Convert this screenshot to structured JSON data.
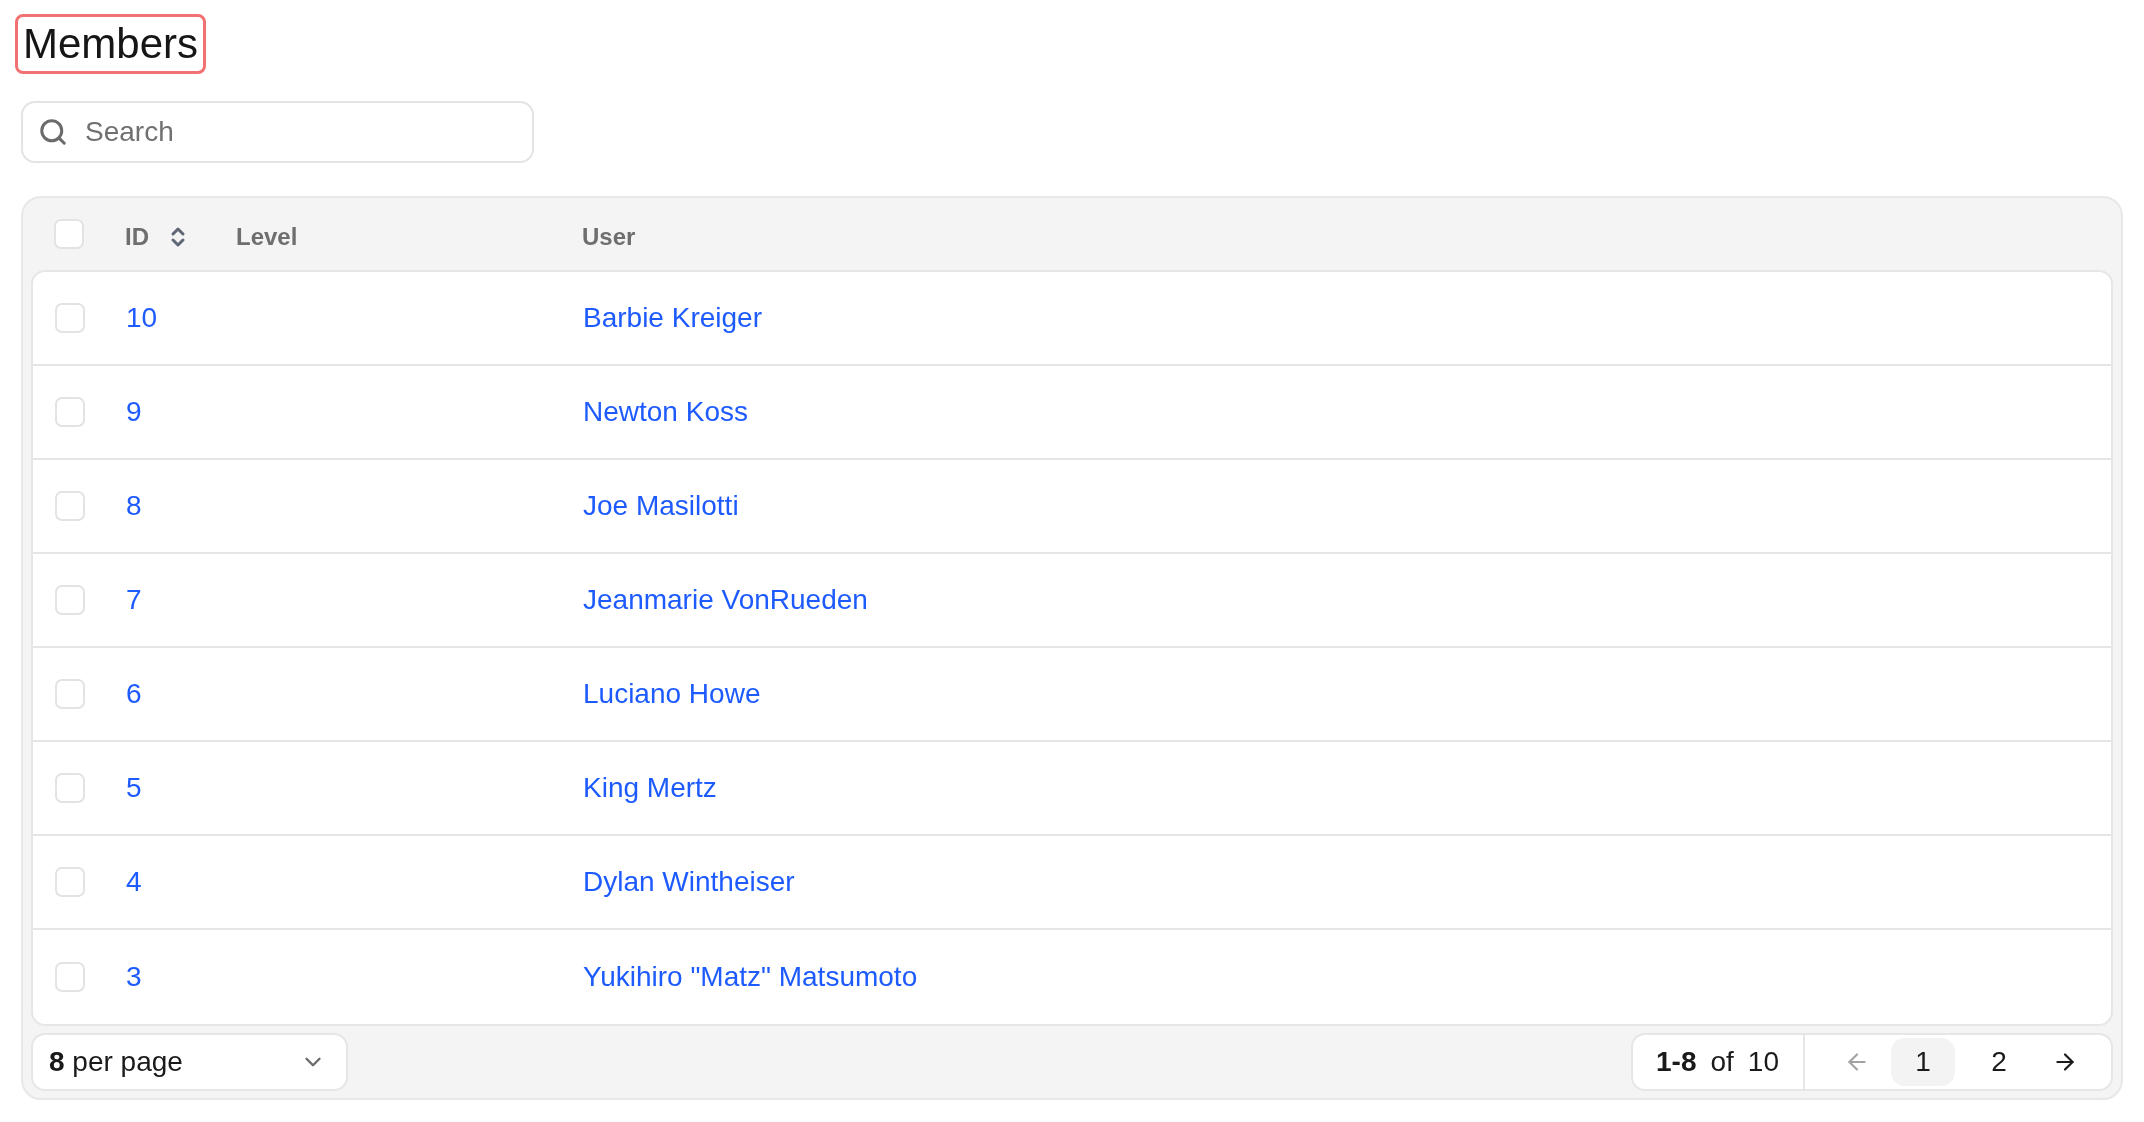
{
  "title": {
    "text": "Members",
    "highlighted": true
  },
  "search": {
    "placeholder": "Search"
  },
  "table": {
    "select_all": {
      "checked": false
    },
    "columns": [
      {
        "label": "ID",
        "sortable": true
      },
      {
        "label": "Level",
        "sortable": false
      },
      {
        "label": "User",
        "sortable": false
      }
    ],
    "rows": [
      {
        "checked": false,
        "id": "10",
        "user": "Barbie Kreiger"
      },
      {
        "checked": false,
        "id": "9",
        "user": "Newton Koss"
      },
      {
        "checked": false,
        "id": "8",
        "user": "Joe Masilotti"
      },
      {
        "checked": false,
        "id": "7",
        "user": "Jeanmarie VonRueden"
      },
      {
        "checked": false,
        "id": "6",
        "user": "Luciano Howe"
      },
      {
        "checked": false,
        "id": "5",
        "user": "King Mertz"
      },
      {
        "checked": false,
        "id": "4",
        "user": "Dylan Wintheiser"
      },
      {
        "checked": false,
        "id": "3",
        "user": "Yukihiro \"Matz\" Matsumoto"
      }
    ]
  },
  "footer": {
    "per_page": {
      "value": "8",
      "label": "per page"
    },
    "range": {
      "shown": "1-8",
      "of": "of",
      "total": "10"
    },
    "pagination": {
      "previous": {
        "disabled": true
      },
      "pages": [
        {
          "label": "1",
          "selected": true
        },
        {
          "label": "2",
          "selected": false
        }
      ],
      "next": {
        "disabled": false
      }
    }
  }
}
